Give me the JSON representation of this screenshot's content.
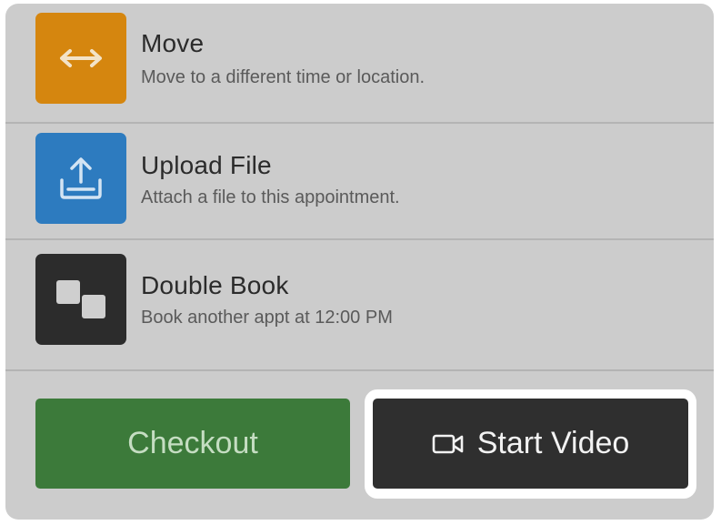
{
  "actions": [
    {
      "title": "Move",
      "subtitle": "Move to a different time or location.",
      "icon": "arrows-horizontal-icon",
      "color": "#d5860f"
    },
    {
      "title": "Upload File",
      "subtitle": "Attach a file to this appointment.",
      "icon": "upload-icon",
      "color": "#2d7bbf"
    },
    {
      "title": "Double Book",
      "subtitle": "Book another appt at 12:00 PM",
      "icon": "double-squares-icon",
      "color": "#2c2c2c"
    }
  ],
  "buttons": {
    "checkout_label": "Checkout",
    "checkout_color": "#3c7a3a",
    "start_video_label": "Start Video",
    "start_video_icon": "video-camera-icon",
    "start_video_color": "#2f2f2f"
  }
}
